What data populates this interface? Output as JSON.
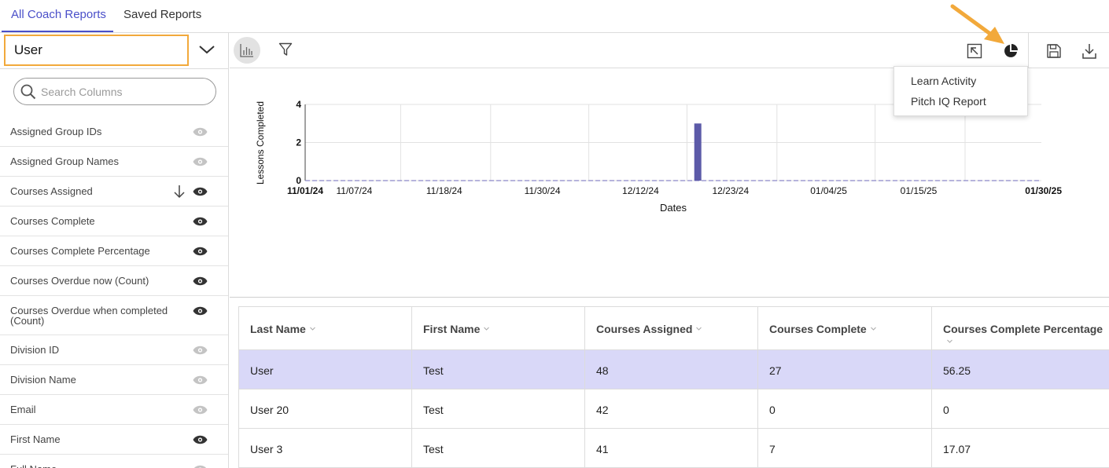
{
  "tabs": [
    {
      "label": "All Coach Reports",
      "active": true
    },
    {
      "label": "Saved Reports",
      "active": false
    }
  ],
  "sidebar": {
    "selected_entity": "User",
    "search_placeholder": "Search Columns",
    "columns": [
      {
        "label": "Assigned Group IDs",
        "visible": false
      },
      {
        "label": "Assigned Group Names",
        "visible": false
      },
      {
        "label": "Courses Assigned",
        "visible": true,
        "sorted": "descending"
      },
      {
        "label": "Courses Complete",
        "visible": true
      },
      {
        "label": "Courses Complete Percentage",
        "visible": true
      },
      {
        "label": "Courses Overdue now (Count)",
        "visible": true
      },
      {
        "label": "Courses Overdue when completed (Count)",
        "visible": true
      },
      {
        "label": "Division ID",
        "visible": false
      },
      {
        "label": "Division Name",
        "visible": false
      },
      {
        "label": "Email",
        "visible": false
      },
      {
        "label": "First Name",
        "visible": true
      },
      {
        "label": "Full Name",
        "visible": false
      }
    ]
  },
  "menu": {
    "items": [
      "Learn Activity",
      "Pitch IQ Report"
    ]
  },
  "colors": {
    "accent": "#4a4fc9",
    "highlight_border": "#f2a93b",
    "bar": "#5c5aa8",
    "row_highlight": "#d9d8f8"
  },
  "chart_data": {
    "type": "bar",
    "xlabel": "Dates",
    "ylabel": "Lessons Completed",
    "ylim": [
      0,
      4
    ],
    "yticks": [
      "0",
      "2",
      "4"
    ],
    "xticks": [
      "11/01/24",
      "11/07/24",
      "11/18/24",
      "11/30/24",
      "12/12/24",
      "12/23/24",
      "01/04/25",
      "01/15/25",
      "01/30/25"
    ],
    "start_date": "11/01/24",
    "end_date": "01/30/25",
    "values": [
      {
        "date": "12/19/24",
        "value": 3
      }
    ],
    "grid": true
  },
  "table": {
    "columns": [
      "Last Name",
      "First Name",
      "Courses Assigned",
      "Courses Complete",
      "Courses Complete Percentage"
    ],
    "rows": [
      [
        "User",
        "Test",
        "48",
        "27",
        "56.25"
      ],
      [
        "User 20",
        "Test",
        "42",
        "0",
        "0"
      ],
      [
        "User 3",
        "Test",
        "41",
        "7",
        "17.07"
      ]
    ]
  }
}
